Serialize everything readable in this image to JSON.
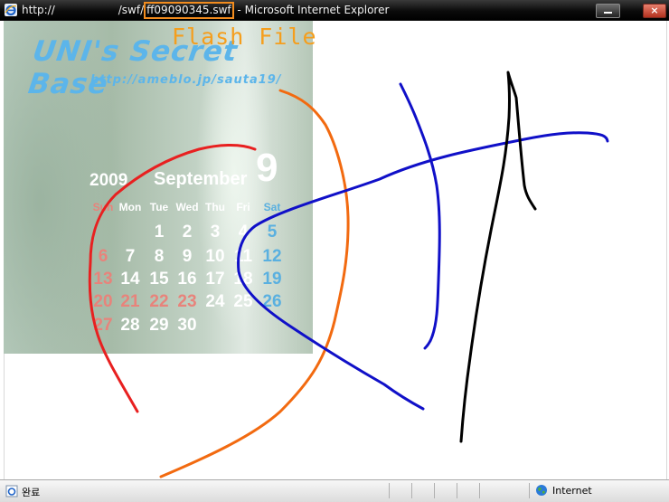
{
  "window": {
    "title_prefix": "http://",
    "title_path": "/swf/",
    "title_file": "ff09090345.swf",
    "title_suffix": " - Microsoft Internet Explorer",
    "close_symbol": "×"
  },
  "annotation": {
    "flash_label": "Flash File",
    "color": "#f59e1d"
  },
  "flash": {
    "blog_title": "UNI's Secret Base",
    "blog_url": "http://ameblo.jp/sauta19/",
    "title_color": "#5cb5ea",
    "calendar": {
      "year": "2009",
      "month": "September",
      "month_number": "9",
      "weekdays": [
        "Sun",
        "Mon",
        "Tue",
        "Wed",
        "Thu",
        "Fri",
        "Sat"
      ],
      "weeks": [
        [
          "",
          "",
          "1",
          "2",
          "3",
          "4",
          "5"
        ],
        [
          "6",
          "7",
          "8",
          "9",
          "10",
          "11",
          "12"
        ],
        [
          "13",
          "14",
          "15",
          "16",
          "17",
          "18",
          "19"
        ],
        [
          "20",
          "21",
          "22",
          "23",
          "24",
          "25",
          "26"
        ],
        [
          "27",
          "28",
          "29",
          "30",
          "",
          "",
          ""
        ]
      ],
      "colors": {
        "sunday": "#e8837b",
        "saturday": "#5ab0e0",
        "holiday": "#e8837b",
        "weekday": "#ffffff"
      }
    }
  },
  "status": {
    "left_text": "완료",
    "zone": "Internet"
  },
  "icons": {
    "browser": "ie-logo-icon",
    "status": "page-done-icon",
    "zone": "globe-icon"
  }
}
